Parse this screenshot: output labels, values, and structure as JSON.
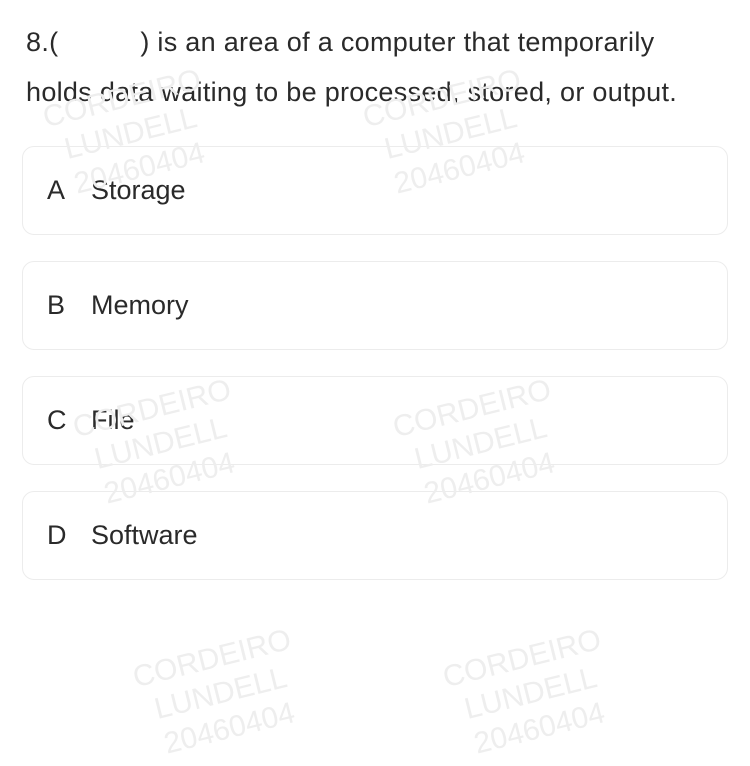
{
  "question": {
    "number": "8.",
    "blank": "(   )",
    "stem_rest": " is an area of a computer that temporarily holds data waiting to be processed, stored, or output."
  },
  "options": [
    {
      "letter": "A",
      "label": "Storage"
    },
    {
      "letter": "B",
      "label": "Memory"
    },
    {
      "letter": "C",
      "label": "File"
    },
    {
      "letter": "D",
      "label": "Software"
    }
  ],
  "watermark": {
    "line1": "CORDEIRO",
    "line2": "LUNDELL",
    "line3": "20460404"
  }
}
